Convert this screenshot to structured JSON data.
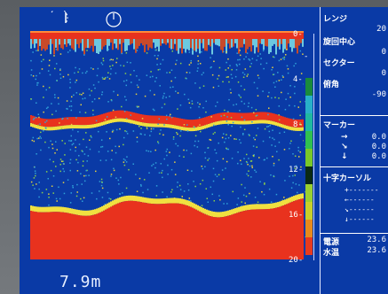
{
  "depth_readout": "7.9m",
  "depth_scale": [
    "0",
    "4",
    "8",
    "12",
    "16",
    "20"
  ],
  "panel": {
    "range_label": "レンジ",
    "range_value": "20",
    "rotation_center_label": "旋回中心",
    "rotation_center_value": "0",
    "sector_label": "セクター",
    "sector_value": "0",
    "tilt_label": "俯角",
    "tilt_value": "-90",
    "marker_label": "マーカー",
    "marker_rows": [
      {
        "symbol": "→",
        "value": "0.0"
      },
      {
        "symbol": "↘",
        "value": "0.0"
      },
      {
        "symbol": "↓",
        "value": "0.0"
      }
    ],
    "crosshair_label": "十字カーソル",
    "crosshair_rows": [
      "+-------",
      "←------",
      "↘------",
      "↓------"
    ],
    "power_label": "電源",
    "power_value": "23.6",
    "water_temp_label": "水温",
    "water_temp_value": "23.6"
  },
  "colors": {
    "background": "#0a3aa6",
    "strong_echo": "#e8321e",
    "weak_echo": "#2fa0d8"
  },
  "colorbar_colors": [
    "#1a8a3c",
    "#28b0c8",
    "#1fb9a0",
    "#30c050",
    "#7ac828",
    "#0b2a14",
    "#9ad030",
    "#c8d02a",
    "#e88a1c",
    "#e83a1e"
  ],
  "icons": [
    "sector-fan-icon",
    "compass-dial-icon"
  ]
}
